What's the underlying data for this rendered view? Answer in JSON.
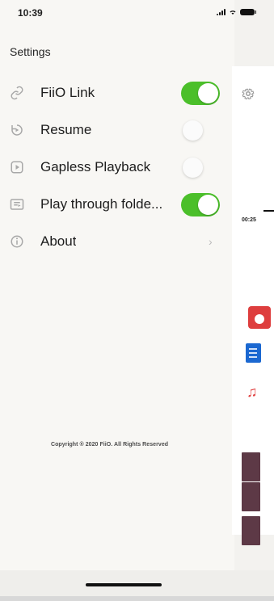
{
  "status_bar": {
    "time": "10:39"
  },
  "header": {
    "title": "Settings"
  },
  "menu": {
    "items": [
      {
        "label": "FiiO Link",
        "toggle": "on",
        "icon": "link-icon"
      },
      {
        "label": "Resume",
        "toggle": "off",
        "icon": "resume-icon"
      },
      {
        "label": "Gapless Playback",
        "toggle": "off",
        "icon": "gapless-icon"
      },
      {
        "label": "Play through folde...",
        "toggle": "on",
        "icon": "folder-play-icon"
      },
      {
        "label": "About",
        "chevron": "›",
        "icon": "info-icon"
      }
    ]
  },
  "footer": {
    "copyright": "Copyright ® 2020 FiiO. All Rights Reserved"
  },
  "right_panel": {
    "time_label": "00:25",
    "icons": [
      "gear-icon",
      "red-box-icon",
      "document-icon",
      "music-note-icon"
    ]
  },
  "colors": {
    "toggle_on": "#4bbf2a",
    "accent_red": "#de3e3e",
    "doc_blue": "#1b68d1"
  }
}
